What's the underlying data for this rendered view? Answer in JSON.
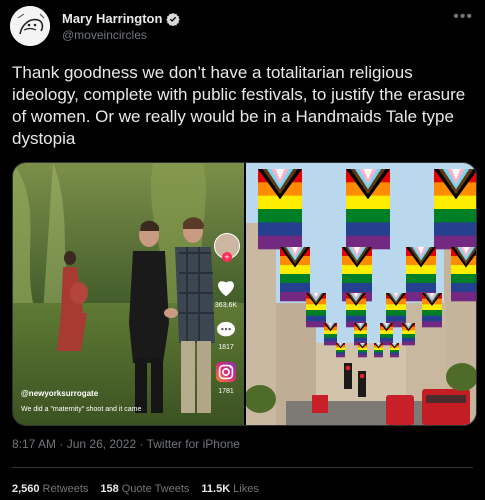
{
  "author": {
    "name": "Mary Harrington",
    "handle": "@moveincircles",
    "verified_icon": "verified-badge-icon",
    "avatar_icon": "avatar-sketch"
  },
  "menu_icon": "more-options-icon",
  "tweet": {
    "text": "Thank goodness we don’t have a totalitarian religious ideology, complete with public festivals, to  justify the erasure of women. Or we really would be in a Handmaids Tale type dystopia"
  },
  "media": {
    "left": {
      "tiktok_counts": [
        "363.6K",
        "1817",
        "1781"
      ],
      "overlay_handle": "@newyorksurrogate",
      "overlay_caption": "We did a \"maternity\" shoot and it came"
    },
    "right": {
      "description_icon": "progress-pride-flags"
    }
  },
  "meta": {
    "time": "8:17 AM",
    "date": "Jun 26, 2022",
    "source": "Twitter for iPhone"
  },
  "stats": {
    "retweets_count": "2,560",
    "retweets_label": "Retweets",
    "quotes_count": "158",
    "quotes_label": "Quote Tweets",
    "likes_count": "11.5K",
    "likes_label": "Likes"
  },
  "colors": {
    "background": "#000000",
    "text": "#e7e9ea",
    "secondary": "#71767b",
    "verified": "#1d9bf0",
    "divider": "#2f3336"
  }
}
